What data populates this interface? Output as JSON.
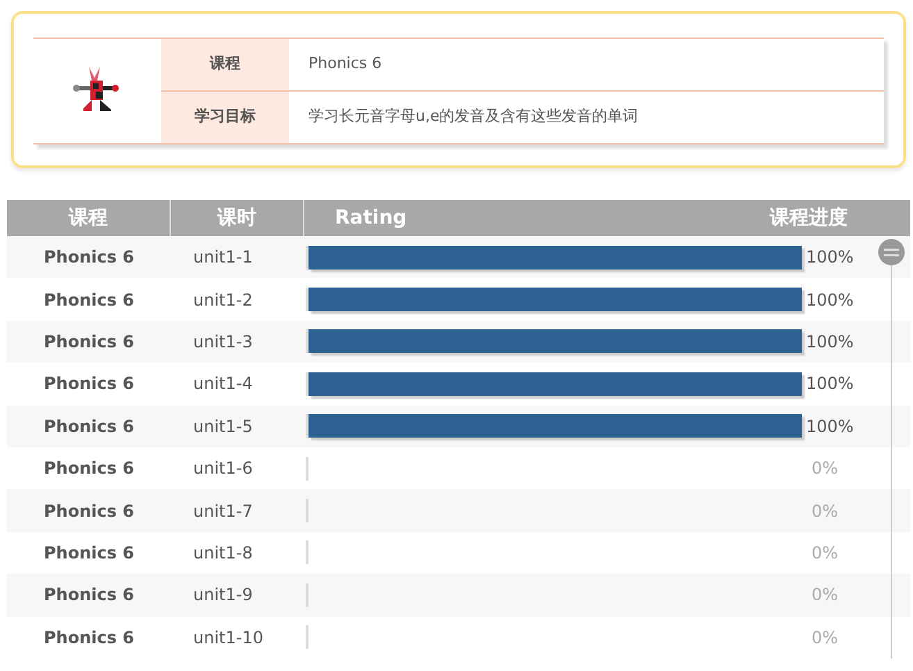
{
  "course_info": {
    "rows": [
      {
        "label": "课程",
        "value": "Phonics 6"
      },
      {
        "label": "学习目标",
        "value": "学习长元音字母u,e的发音及含有这些发音的单词"
      }
    ]
  },
  "table": {
    "columns": [
      "课程",
      "课时",
      "Rating",
      "课程进度"
    ],
    "rows": [
      {
        "course": "Phonics 6",
        "lesson": "unit1-1",
        "level": 1,
        "progress": "100%"
      },
      {
        "course": "Phonics 6",
        "lesson": "unit1-2",
        "level": 1,
        "progress": "100%"
      },
      {
        "course": "Phonics 6",
        "lesson": "unit1-3",
        "level": 1,
        "progress": "100%"
      },
      {
        "course": "Phonics 6",
        "lesson": "unit1-4",
        "level": 1,
        "progress": "100%"
      },
      {
        "course": "Phonics 6",
        "lesson": "unit1-5",
        "level": 1,
        "progress": "100%"
      },
      {
        "course": "Phonics 6",
        "lesson": "unit1-6",
        "level": 0,
        "progress": "0%"
      },
      {
        "course": "Phonics 6",
        "lesson": "unit1-7",
        "level": 0,
        "progress": "0%"
      },
      {
        "course": "Phonics 6",
        "lesson": "unit1-8",
        "level": 0,
        "progress": "0%"
      },
      {
        "course": "Phonics 6",
        "lesson": "unit1-9",
        "level": 0,
        "progress": "0%"
      },
      {
        "course": "Phonics 6",
        "lesson": "unit1-10",
        "level": 0,
        "progress": "0%"
      }
    ]
  }
}
